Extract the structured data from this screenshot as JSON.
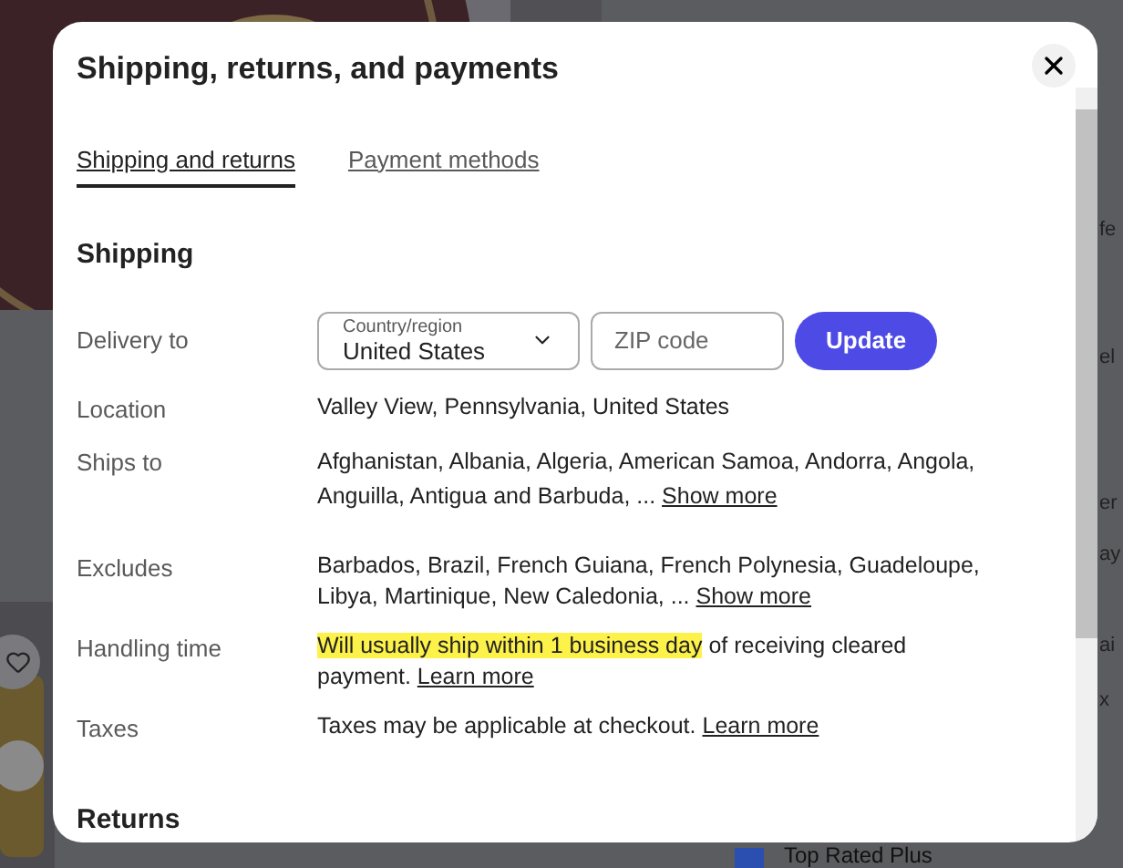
{
  "background": {
    "fragments": [
      "fe",
      "el",
      "er",
      "ay",
      "ai",
      "x"
    ],
    "badge": "Top Rated Plus"
  },
  "dialog": {
    "title": "Shipping, returns, and payments",
    "tabs": [
      {
        "label": "Shipping and returns",
        "selected": true
      },
      {
        "label": "Payment methods",
        "selected": false
      }
    ],
    "section": "Shipping",
    "delivery": {
      "label": "Delivery to",
      "country_label": "Country/region",
      "country": "United States",
      "zip_placeholder": "ZIP code",
      "button": "Update"
    },
    "rows": [
      {
        "label": "Location",
        "text": "Valley View, Pennsylvania, United States"
      },
      {
        "label": "Ships to",
        "text": "Afghanistan, Albania, Algeria, American Samoa, Andorra, Angola, Anguilla, Antigua and Barbuda, ...",
        "link": "Show more"
      },
      {
        "label": "Excludes",
        "text": "Barbados, Brazil, French Guiana, French Polynesia, Guadeloupe, Libya, Martinique, New Caledonia, ...",
        "link": "Show more"
      },
      {
        "label": "Handling time",
        "highlight": "Will usually ship within 1 business day",
        "text": "of receiving cleared payment.",
        "link": "Learn more"
      },
      {
        "label": "Taxes",
        "text": "Taxes may be applicable at checkout.",
        "link": "Learn more"
      }
    ],
    "section_2": "Returns"
  }
}
